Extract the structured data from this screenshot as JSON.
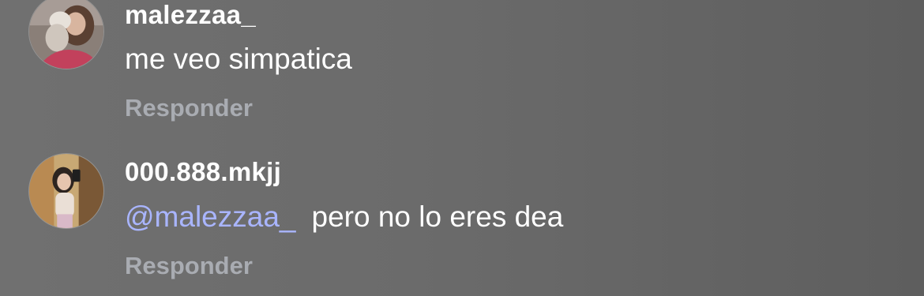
{
  "comments": [
    {
      "username": "malezzaa_",
      "mention": "",
      "text": "me veo simpatica",
      "reply_label": "Responder"
    },
    {
      "username": "000.888.mkjj",
      "mention": "@malezzaa_",
      "text": "pero no lo eres dea",
      "reply_label": "Responder"
    }
  ],
  "colors": {
    "mention": "#a9b5ff",
    "reply": "#a9acb2",
    "text": "#ffffff"
  }
}
